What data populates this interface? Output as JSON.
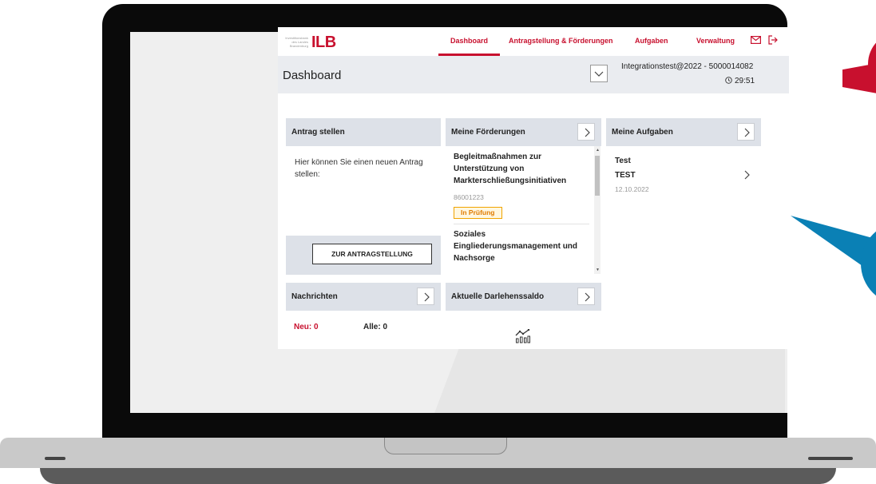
{
  "app": {
    "logo": {
      "small_text": "Investitionsbank des Landes Brandenburg",
      "brand": "ILB"
    },
    "nav": [
      {
        "label": "Dashboard",
        "active": true
      },
      {
        "label": "Antragstellung & Förderungen"
      },
      {
        "label": "Aufgaben"
      },
      {
        "label": "Verwaltung"
      }
    ],
    "icons": {
      "mail": "mail-icon",
      "logout": "logout-icon",
      "clock": "clock-icon",
      "chart": "chart-icon"
    },
    "page_title": "Dashboard",
    "user": {
      "info": "Integrationstest@2022 - 5000014082",
      "timer": "29:51"
    },
    "cards": {
      "antrag": {
        "title": "Antrag stellen",
        "text": "Hier können Sie einen neuen Antrag stellen:",
        "button": "ZUR ANTRAGSTELLUNG"
      },
      "foerderungen": {
        "title": "Meine Förderungen",
        "items": [
          {
            "title": "Begleitmaßnahmen zur Unterstützung von Markterschließungsinitiativen",
            "number": "86001223",
            "status": "In Prüfung"
          },
          {
            "title": "Soziales Eingliederungsmanagement und Nachsorge"
          }
        ]
      },
      "aufgaben": {
        "title": "Meine Aufgaben",
        "item": {
          "line1": "Test",
          "line2": "TEST",
          "date": "12.10.2022"
        }
      },
      "nachrichten": {
        "title": "Nachrichten",
        "neu": "Neu: 0",
        "alle": "Alle: 0"
      },
      "darlehen": {
        "title": "Aktuelle Darlehenssaldo"
      }
    }
  },
  "colors": {
    "brand_red": "#c8102e",
    "header_gray": "#dde1e8",
    "badge_orange": "#e07b00"
  }
}
